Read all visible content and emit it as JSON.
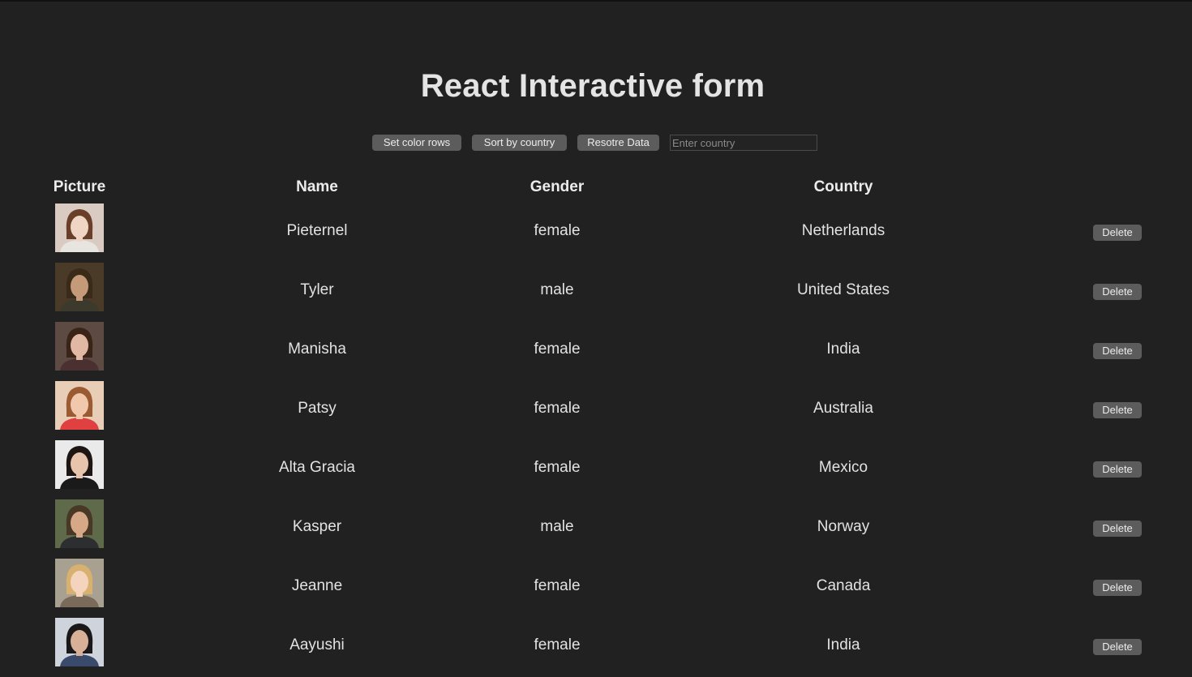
{
  "title": "React Interactive form",
  "controls": {
    "set_color_rows": "Set color rows",
    "sort_by_country": "Sort by country",
    "restore_data": "Resotre Data",
    "country_placeholder": "Enter country",
    "country_value": ""
  },
  "table": {
    "headers": {
      "picture": "Picture",
      "name": "Name",
      "gender": "Gender",
      "country": "Country"
    },
    "delete_label": "Delete",
    "rows": [
      {
        "name": "Pieternel",
        "gender": "female",
        "country": "Netherlands",
        "avatar": {
          "bg": "#d9cbc2",
          "hair": "#6a3f2a",
          "skin": "#f0d5c5",
          "shirt": "#e8e4e0"
        }
      },
      {
        "name": "Tyler",
        "gender": "male",
        "country": "United States",
        "avatar": {
          "bg": "#4a3a28",
          "hair": "#3a2a1a",
          "skin": "#c49a78",
          "shirt": "#3b3a2c"
        }
      },
      {
        "name": "Manisha",
        "gender": "female",
        "country": "India",
        "avatar": {
          "bg": "#5d4a42",
          "hair": "#3a2418",
          "skin": "#e0b8a4",
          "shirt": "#4a3030"
        }
      },
      {
        "name": "Patsy",
        "gender": "female",
        "country": "Australia",
        "avatar": {
          "bg": "#e8cdb7",
          "hair": "#9a5a32",
          "skin": "#f2c8ac",
          "shirt": "#e04040"
        }
      },
      {
        "name": "Alta Gracia",
        "gender": "female",
        "country": "Mexico",
        "avatar": {
          "bg": "#eaeaea",
          "hair": "#1e1612",
          "skin": "#e8c4ac",
          "shirt": "#1a1a1a"
        }
      },
      {
        "name": "Kasper",
        "gender": "male",
        "country": "Norway",
        "avatar": {
          "bg": "#5e6a4a",
          "hair": "#4a3826",
          "skin": "#d6a888",
          "shirt": "#2c2e30"
        }
      },
      {
        "name": "Jeanne",
        "gender": "female",
        "country": "Canada",
        "avatar": {
          "bg": "#a8a090",
          "hair": "#d8b070",
          "skin": "#f4d4bc",
          "shirt": "#7a6a5a"
        }
      },
      {
        "name": "Aayushi",
        "gender": "female",
        "country": "India",
        "avatar": {
          "bg": "#cfd4dc",
          "hair": "#1a1818",
          "skin": "#d8b098",
          "shirt": "#3a4a6a"
        }
      }
    ]
  }
}
